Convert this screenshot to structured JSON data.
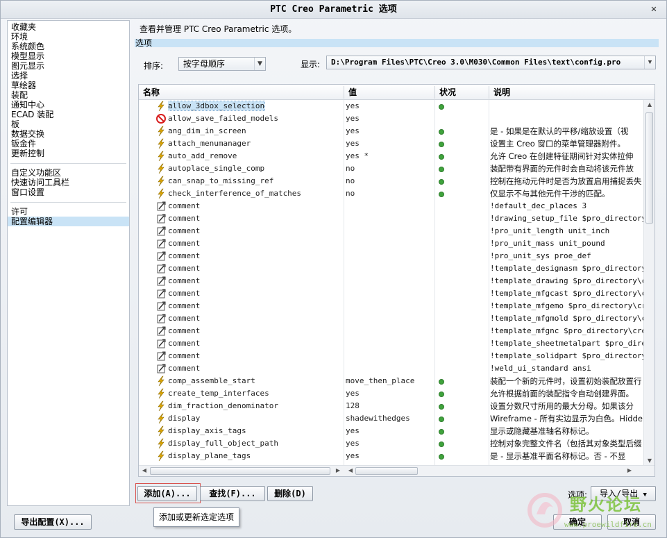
{
  "window": {
    "title": "PTC Creo Parametric 选项",
    "close_glyph": "✕"
  },
  "nav": {
    "group1": [
      "收藏夹",
      "环境",
      "系统颜色",
      "模型显示",
      "图元显示",
      "选择",
      "草绘器",
      "装配",
      "通知中心",
      "ECAD 装配",
      "板",
      "数据交换",
      "钣金件",
      "更新控制"
    ],
    "group2": [
      "自定义功能区",
      "快速访问工具栏",
      "窗口设置"
    ],
    "group3": [
      "许可",
      "配置编辑器"
    ],
    "selected": "配置编辑器"
  },
  "main": {
    "description": "查看并管理 PTC Creo Parametric 选项。",
    "section_title": "选项",
    "sort_label": "排序:",
    "sort_value": "按字母顺序",
    "display_label": "显示:",
    "display_value": "D:\\Program Files\\PTC\\Creo 3.0\\M030\\Common Files\\text\\config.pro"
  },
  "table": {
    "headers": {
      "name": "名称",
      "value": "值",
      "status": "状况",
      "desc": "说明"
    },
    "rows": [
      {
        "icon": "lightning-icon",
        "name": "allow_3dbox_selection",
        "value": "yes",
        "status": true,
        "desc": "",
        "selected": true
      },
      {
        "icon": "no-entry-icon",
        "name": "allow_save_failed_models",
        "value": "yes",
        "status": false,
        "desc": ""
      },
      {
        "icon": "lightning-icon",
        "name": "ang_dim_in_screen",
        "value": "yes",
        "status": true,
        "desc": "是 - 如果是在默认的平移/缩放设置（视"
      },
      {
        "icon": "lightning-icon",
        "name": "attach_menumanager",
        "value": "yes",
        "status": true,
        "desc": "设置主 Creo 窗口的菜单管理器附件。"
      },
      {
        "icon": "lightning-icon",
        "name": "auto_add_remove",
        "value": "yes *",
        "status": true,
        "desc": "允许 Creo 在创建特征期间针对实体拉伸"
      },
      {
        "icon": "lightning-icon",
        "name": "autoplace_single_comp",
        "value": "no",
        "status": true,
        "desc": "装配带有界面的元件时会自动将该元件放"
      },
      {
        "icon": "lightning-icon",
        "name": "can_snap_to_missing_ref",
        "value": "no",
        "status": true,
        "desc": "控制在拖动元件时是否为放置启用捕捉丢失"
      },
      {
        "icon": "lightning-icon",
        "name": "check_interference_of_matches",
        "value": "no",
        "status": true,
        "desc": "仅显示不与其他元件干涉的匹配。"
      },
      {
        "icon": "comment-icon",
        "name": "comment",
        "value": "",
        "status": false,
        "desc": "!default_dec_places 3",
        "mono": true
      },
      {
        "icon": "comment-icon",
        "name": "comment",
        "value": "",
        "status": false,
        "desc": "!drawing_setup_file $pro_directory\\cr",
        "mono": true
      },
      {
        "icon": "comment-icon",
        "name": "comment",
        "value": "",
        "status": false,
        "desc": "!pro_unit_length unit_inch",
        "mono": true
      },
      {
        "icon": "comment-icon",
        "name": "comment",
        "value": "",
        "status": false,
        "desc": "!pro_unit_mass unit_pound",
        "mono": true
      },
      {
        "icon": "comment-icon",
        "name": "comment",
        "value": "",
        "status": false,
        "desc": "!pro_unit_sys proe_def",
        "mono": true
      },
      {
        "icon": "comment-icon",
        "name": "comment",
        "value": "",
        "status": false,
        "desc": "!template_designasm $pro_directory\\cr",
        "mono": true
      },
      {
        "icon": "comment-icon",
        "name": "comment",
        "value": "",
        "status": false,
        "desc": "!template_drawing $pro_directory\\cre",
        "mono": true
      },
      {
        "icon": "comment-icon",
        "name": "comment",
        "value": "",
        "status": false,
        "desc": "!template_mfgcast $pro_directory\\cre",
        "mono": true
      },
      {
        "icon": "comment-icon",
        "name": "comment",
        "value": "",
        "status": false,
        "desc": "!template_mfgemo $pro_directory\\creo",
        "mono": true
      },
      {
        "icon": "comment-icon",
        "name": "comment",
        "value": "",
        "status": false,
        "desc": "!template_mfgmold $pro_directory\\cre",
        "mono": true
      },
      {
        "icon": "comment-icon",
        "name": "comment",
        "value": "",
        "status": false,
        "desc": "!template_mfgnc $pro_directory\\creo_",
        "mono": true
      },
      {
        "icon": "comment-icon",
        "name": "comment",
        "value": "",
        "status": false,
        "desc": "!template_sheetmetalpart $pro_directo",
        "mono": true
      },
      {
        "icon": "comment-icon",
        "name": "comment",
        "value": "",
        "status": false,
        "desc": "!template_solidpart $pro_directory\\cr",
        "mono": true
      },
      {
        "icon": "comment-icon",
        "name": "comment",
        "value": "",
        "status": false,
        "desc": "!weld_ui_standard ansi",
        "mono": true
      },
      {
        "icon": "lightning-icon",
        "name": "comp_assemble_start",
        "value": "move_then_place",
        "status": true,
        "desc": "装配一个新的元件时，设置初始装配放置行"
      },
      {
        "icon": "lightning-icon",
        "name": "create_temp_interfaces",
        "value": "yes",
        "status": true,
        "desc": "允许根据前面的装配指令自动创建界面。"
      },
      {
        "icon": "lightning-icon",
        "name": "dim_fraction_denominator",
        "value": "128",
        "status": true,
        "desc": "设置分数尺寸所用的最大分母。如果该分"
      },
      {
        "icon": "lightning-icon",
        "name": "display",
        "value": "shadewithedges",
        "status": true,
        "desc": "Wireframe - 所有实边显示为白色。Hidde"
      },
      {
        "icon": "lightning-icon",
        "name": "display_axis_tags",
        "value": "yes",
        "status": true,
        "desc": "显示或隐藏基准轴名称标记。"
      },
      {
        "icon": "lightning-icon",
        "name": "display_full_object_path",
        "value": "yes",
        "status": true,
        "desc": "控制对象完整文件名（包括其对象类型后缀"
      },
      {
        "icon": "lightning-icon",
        "name": "display_plane_tags",
        "value": "yes",
        "status": true,
        "desc": "是 - 显示基准平面名称标记。否 - 不显"
      }
    ]
  },
  "buttons": {
    "add": "添加(A)...",
    "find": "查找(F)...",
    "delete": "删除(D)",
    "options_label": "选项:",
    "import_export": "导入/导出",
    "export_config": "导出配置(X)...",
    "ok": "确定",
    "cancel": "取消"
  },
  "tooltip": "添加或更新选定选项",
  "watermark": {
    "text": "野火论坛",
    "url": "www.proewildfire.cn"
  },
  "colors": {
    "selection": "#c9e3f6",
    "status_green": "#3fa33c",
    "lightning": "#e0a800",
    "no_entry": "#d81e1e"
  }
}
